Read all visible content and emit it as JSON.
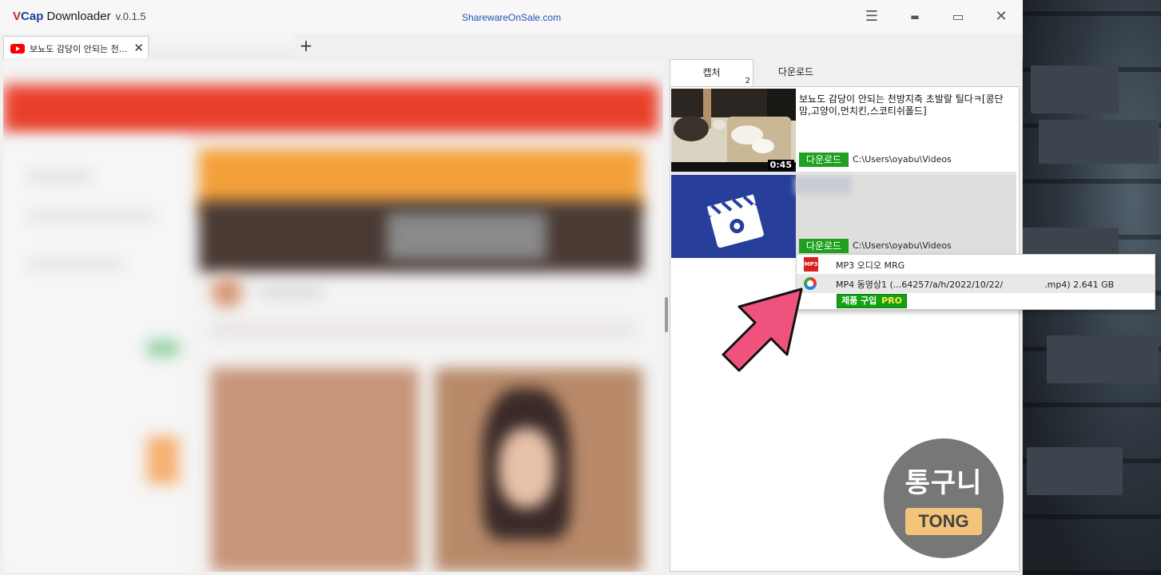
{
  "window": {
    "brand_v": "V",
    "brand_cap": "Cap",
    "brand_rest": " Downloader",
    "version": "v.0.1.5",
    "center_link": "SharewareOnSale.com",
    "menu_glyph": "☰",
    "minimize_glyph": "▬",
    "maximize_glyph": "▭",
    "close_glyph": "✕"
  },
  "browser_tabs": {
    "tabs": [
      {
        "title": "보뇨도 감당이 안되는 천...",
        "icon": "youtube-icon",
        "close": "✕"
      }
    ],
    "add_label": "+"
  },
  "panel": {
    "tabs": [
      {
        "label": "캡처",
        "badge": "2",
        "active": true
      },
      {
        "label": "다운로드",
        "active": false
      }
    ],
    "items": [
      {
        "title": "보뇨도 감당이 안되는 천방지축 초발랄 틸다ㅋ[콩단맘,고양이,먼치킨,스코티쉬폴드]",
        "duration": "0:45",
        "download_label": "다운로드",
        "path": "C:\\Users\\oyabu\\Videos"
      },
      {
        "title": "",
        "download_label": "다운로드",
        "path": "C:\\Users\\oyabu\\Videos",
        "thumb_icon": "clapperboard-icon"
      }
    ]
  },
  "format_menu": {
    "options": [
      {
        "label": "MP3 오디오 MRG",
        "icon": "mp3-icon",
        "icon_text": "MP3"
      },
      {
        "label": "MP4 동영상1 (...64257/a/h/2022/10/22/",
        "label_tail": ".mp4) 2.641 GB",
        "icon": "mp4-icon"
      }
    ],
    "buy_label": "제품 구입",
    "buy_pro": "PRO"
  },
  "watermark": {
    "line1": "통구니",
    "line2": "TONG"
  },
  "colors": {
    "download_green": "#1fa01f",
    "pointer_pink": "#f0527e",
    "brand_red": "#d61f1f",
    "brand_blue": "#1b3f9c",
    "link_blue": "#2250b8"
  }
}
